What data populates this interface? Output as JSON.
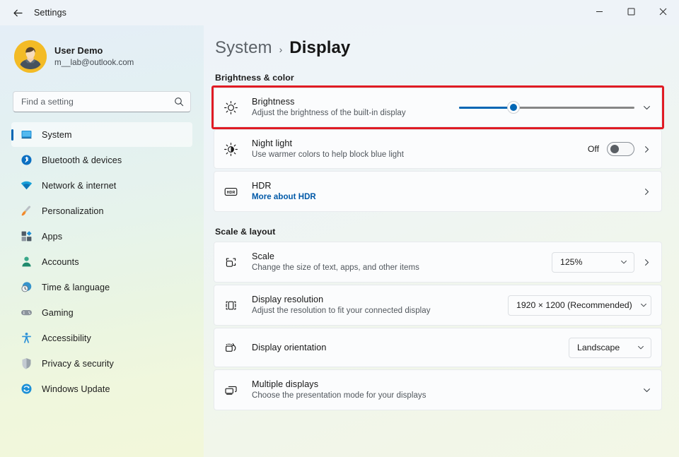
{
  "window": {
    "title": "Settings",
    "back_icon": "back-arrow-icon",
    "minimize_label": "Minimize",
    "maximize_label": "Maximize",
    "close_label": "Close"
  },
  "accent_color": "#0066b4",
  "highlight_color": "#e01b24",
  "link_color": "#0059a8",
  "sidebar": {
    "profile": {
      "name": "User Demo",
      "email": "m__lab@outlook.com"
    },
    "search": {
      "placeholder": "Find a setting",
      "value": "",
      "icon": "search-icon"
    },
    "items": [
      {
        "label": "System",
        "icon": "monitor-icon",
        "active": true
      },
      {
        "label": "Bluetooth & devices",
        "icon": "bluetooth-icon",
        "active": false
      },
      {
        "label": "Network & internet",
        "icon": "wifi-icon",
        "active": false
      },
      {
        "label": "Personalization",
        "icon": "paintbrush-icon",
        "active": false
      },
      {
        "label": "Apps",
        "icon": "apps-icon",
        "active": false
      },
      {
        "label": "Accounts",
        "icon": "person-icon",
        "active": false
      },
      {
        "label": "Time & language",
        "icon": "clock-globe-icon",
        "active": false
      },
      {
        "label": "Gaming",
        "icon": "gamepad-icon",
        "active": false
      },
      {
        "label": "Accessibility",
        "icon": "accessibility-icon",
        "active": false
      },
      {
        "label": "Privacy & security",
        "icon": "shield-icon",
        "active": false
      },
      {
        "label": "Windows Update",
        "icon": "update-icon",
        "active": false
      }
    ]
  },
  "breadcrumb": {
    "parent": "System",
    "separator": "›",
    "current": "Display"
  },
  "sections": [
    {
      "title": "Brightness & color",
      "rows": [
        {
          "title": "Brightness",
          "subtitle": "Adjust the brightness of the built-in display",
          "subtitle_is_link": false,
          "icon": "brightness-sun-icon",
          "control": "slider",
          "slider_percent": 31,
          "expand_icon": "chevron-down-icon",
          "highlighted": true
        },
        {
          "title": "Night light",
          "subtitle": "Use warmer colors to help block blue light",
          "subtitle_is_link": false,
          "icon": "night-light-icon",
          "control": "toggle",
          "toggle_label": "Off",
          "toggle_on": false,
          "expand_icon": "chevron-right-icon",
          "highlighted": false
        },
        {
          "title": "HDR",
          "subtitle": "More about HDR",
          "subtitle_is_link": true,
          "icon": "hdr-icon",
          "control": "none",
          "expand_icon": "chevron-right-icon",
          "highlighted": false
        }
      ]
    },
    {
      "title": "Scale & layout",
      "rows": [
        {
          "title": "Scale",
          "subtitle": "Change the size of text, apps, and other items",
          "subtitle_is_link": false,
          "icon": "scale-icon",
          "control": "combo",
          "combo_value": "125%",
          "combo_width": "w-scale",
          "expand_icon": "chevron-right-icon",
          "highlighted": false
        },
        {
          "title": "Display resolution",
          "subtitle": "Adjust the resolution to fit your connected display",
          "subtitle_is_link": false,
          "icon": "resolution-icon",
          "control": "combo",
          "combo_value": "1920 × 1200 (Recommended)",
          "combo_width": "w-res",
          "expand_icon": "none",
          "highlighted": false
        },
        {
          "title": "Display orientation",
          "subtitle": "",
          "subtitle_is_link": false,
          "icon": "orientation-icon",
          "control": "combo",
          "combo_value": "Landscape",
          "combo_width": "w-orient",
          "expand_icon": "none",
          "highlighted": false
        },
        {
          "title": "Multiple displays",
          "subtitle": "Choose the presentation mode for your displays",
          "subtitle_is_link": false,
          "icon": "multiple-displays-icon",
          "control": "none",
          "expand_icon": "chevron-down-icon",
          "highlighted": false
        }
      ]
    }
  ]
}
